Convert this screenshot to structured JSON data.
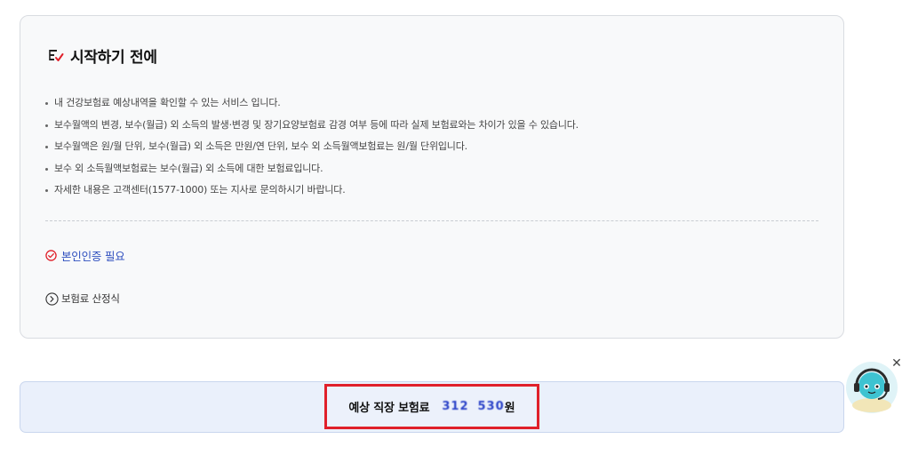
{
  "section": {
    "title": "시작하기 전에",
    "notices": [
      "내 건강보험료 예상내역을 확인할 수 있는 서비스 입니다.",
      "보수월액의 변경, 보수(월급) 외 소득의 발생·변경 및 장기요양보험료 감경 여부 등에 따라 실제 보험료와는 차이가 있을 수 있습니다.",
      "보수월액은 원/월 단위, 보수(월급) 외 소득은 만원/연 단위, 보수 외 소득월액보험료는 원/월 단위입니다.",
      "보수 외 소득월액보험료는 보수(월급) 외 소득에 대한 보험료입니다.",
      "자세한 내용은 고객센터(1577-1000) 또는 지사로 문의하시기 바랍니다."
    ],
    "auth_label": "본인인증 필요",
    "formula_label": "보험료 산정식"
  },
  "result": {
    "label": "예상 직장 보험료",
    "amount_part1": "312",
    "amount_part2": "530",
    "unit": "원"
  },
  "colors": {
    "accent_blue": "#2f4fbf",
    "highlight_red": "#e0202a",
    "result_bg": "#eaf0fb"
  },
  "icons": {
    "heading": "checklist-icon",
    "auth": "check-circle-icon",
    "formula": "chevron-right-circle-icon",
    "chatbot": "chatbot-avatar-icon",
    "close": "close-icon"
  }
}
